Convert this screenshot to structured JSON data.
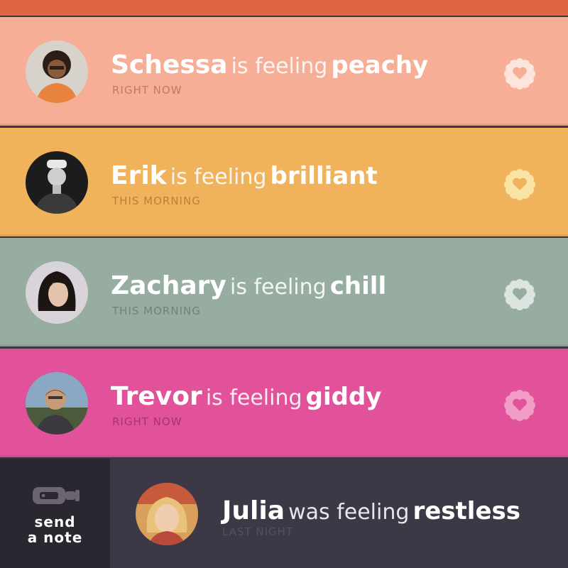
{
  "top_strip_color": "#e0643f",
  "icon_names": {
    "like": "heart-flower-icon",
    "note": "bottle-icon"
  },
  "feed": [
    {
      "name": "Schessa",
      "verb": "is feeling",
      "mood": "peachy",
      "time": "RIGHT NOW",
      "bg": "#f7ae97",
      "time_color": "#c07a66",
      "heart_fill": "#fde5dc",
      "heart_inner": "#f7ae97",
      "avatar_bg": "#d8d2cc"
    },
    {
      "name": "Erik",
      "verb": "is feeling",
      "mood": "brilliant",
      "time": "THIS MORNING",
      "bg": "#f0b25b",
      "time_color": "#b88237",
      "heart_fill": "#fbe3a6",
      "heart_inner": "#f0b25b",
      "avatar_bg": "#1c1c1c"
    },
    {
      "name": "Zachary",
      "verb": "is feeling",
      "mood": "chill",
      "time": "THIS MORNING",
      "bg": "#97ada1",
      "time_color": "#6f8479",
      "heart_fill": "#dbe4de",
      "heart_inner": "#97ada1",
      "avatar_bg": "#d9d4da"
    },
    {
      "name": "Trevor",
      "verb": "is feeling",
      "mood": "giddy",
      "time": "RIGHT NOW",
      "bg": "#e1529b",
      "time_color": "#a8336e",
      "heart_fill": "#f29cc8",
      "heart_inner": "#e1529b",
      "avatar_bg": "#8aa7c4"
    }
  ],
  "send_note": {
    "line1": "send",
    "line2": "a note"
  },
  "latest": {
    "name": "Julia",
    "verb": "was feeling",
    "mood": "restless",
    "time": "LAST NIGHT",
    "time_color": "#55505e"
  }
}
